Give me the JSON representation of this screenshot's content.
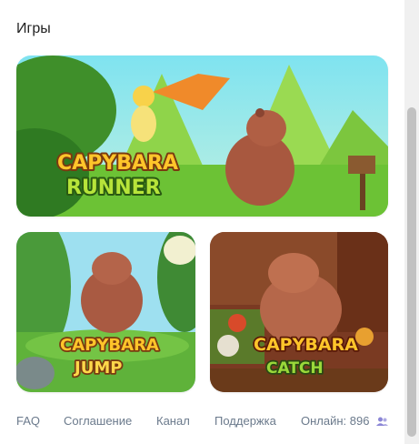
{
  "section": {
    "title": "Игры"
  },
  "games": [
    {
      "id": "runner",
      "logo_line1": "CAPYBARA",
      "logo_line2": "RUNNER"
    },
    {
      "id": "jump",
      "logo_line1": "CAPYBARA",
      "logo_line2": "JUMP"
    },
    {
      "id": "catch",
      "logo_line1": "CAPYBARA",
      "logo_line2": "CATCH"
    }
  ],
  "footer": {
    "links": [
      "FAQ",
      "Соглашение",
      "Канал",
      "Поддержка"
    ],
    "online_label": "Онлайн:",
    "online_count": "896",
    "online_icon": "people-icon"
  },
  "colors": {
    "link": "#6b7a8c",
    "accent": "#8b86d6"
  }
}
